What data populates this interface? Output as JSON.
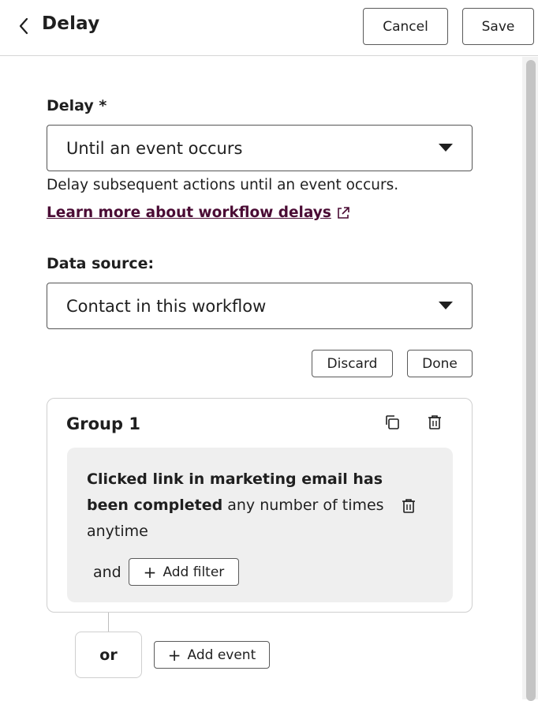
{
  "header": {
    "title": "Delay",
    "cancel_label": "Cancel",
    "save_label": "Save"
  },
  "delay": {
    "label": "Delay *",
    "selected": "Until an event occurs",
    "help_text": "Delay subsequent actions until an event occurs.",
    "learn_more": "Learn more about workflow delays"
  },
  "data_source": {
    "label": "Data source:",
    "selected": "Contact in this workflow"
  },
  "actions": {
    "discard_label": "Discard",
    "done_label": "Done"
  },
  "group": {
    "title": "Group 1",
    "filter_bold": "Clicked link in marketing email has been completed",
    "filter_rest": " any number of times anytime",
    "and_label": "and",
    "add_filter_label": "Add filter"
  },
  "footer": {
    "or_label": "or",
    "add_event_label": "Add event"
  },
  "icons": {
    "back": "chevron-left-icon",
    "external": "external-link-icon",
    "copy": "copy-icon",
    "trash": "trash-icon",
    "caret": "caret-down-icon",
    "plus": "plus-icon"
  },
  "colors": {
    "link": "#4a0b34",
    "inner_card_bg": "#efefef",
    "border": "#5a5a5a"
  }
}
